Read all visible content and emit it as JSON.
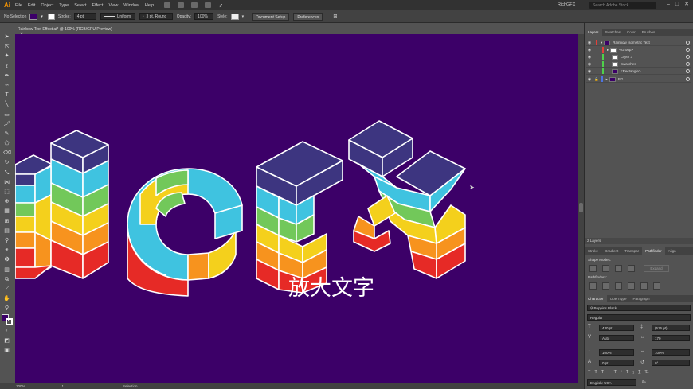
{
  "app": {
    "logo": "Ai",
    "workspace": "RichGFX",
    "search_placeholder": "Search Adobe Stock",
    "accent": "#ff9a00"
  },
  "menu": [
    "File",
    "Edit",
    "Object",
    "Type",
    "Select",
    "Effect",
    "View",
    "Window",
    "Help"
  ],
  "control_bar": {
    "selection_label": "No Selection",
    "fill_color": "#3c0068",
    "stroke_label": "Stroke:",
    "stroke_value": "4 pt",
    "profile_value": "Uniform",
    "brush_value": "3 pt. Round",
    "opacity_label": "Opacity:",
    "opacity_value": "100%",
    "style_label": "Style:",
    "document_setup": "Document Setup",
    "preferences": "Preferences"
  },
  "document": {
    "tab_title": "Rainbow Text Effect.ai* @ 100% (RGB/GPU Preview)",
    "background": "#3c0068",
    "subtitle": "放大文字",
    "rainbow_colors": [
      "#e62a26",
      "#f7931e",
      "#f4d01c",
      "#72c85a",
      "#3fc3e0",
      "#3d3580"
    ]
  },
  "status_bar": {
    "zoom": "100%",
    "artboard": "1",
    "tool": "Selection"
  },
  "layers_panel": {
    "tabs": [
      "Layers",
      "Swatches",
      "Color",
      "Brushes"
    ],
    "rows": [
      {
        "name": "Rainbow Isometric Text",
        "color": "#e3403a",
        "expanded": true
      },
      {
        "name": "<Group>",
        "color": "#e3403a",
        "expanded": false
      },
      {
        "name": "Layer 3",
        "color": "#4fd14b",
        "expanded": false
      },
      {
        "name": "Swatches",
        "color": "#4fd14b",
        "expanded": false
      },
      {
        "name": "<Rectangle>",
        "color": "#4fd14b",
        "expanded": false
      },
      {
        "name": "BG",
        "color": "#4f74e0",
        "expanded": false
      }
    ],
    "count": "2 Layers"
  },
  "pathfinder_panel": {
    "tabs": [
      "Stroke",
      "Gradient",
      "Transpar",
      "Pathfinder",
      "Align"
    ],
    "shape_modes_label": "Shape Modes:",
    "pathfinders_label": "Pathfinders:",
    "expand_label": "Expand"
  },
  "character_panel": {
    "tabs": [
      "Character",
      "OpenType",
      "Paragraph"
    ],
    "font_family": "Poppins Black",
    "font_style": "Regular",
    "font_size": "430 pt",
    "leading": "(516 pt)",
    "kerning": "Auto",
    "tracking": "170",
    "vertical_scale": "100%",
    "horizontal_scale": "100%",
    "baseline_shift": "0 pt",
    "rotation": "0°",
    "language": "English: USA"
  }
}
